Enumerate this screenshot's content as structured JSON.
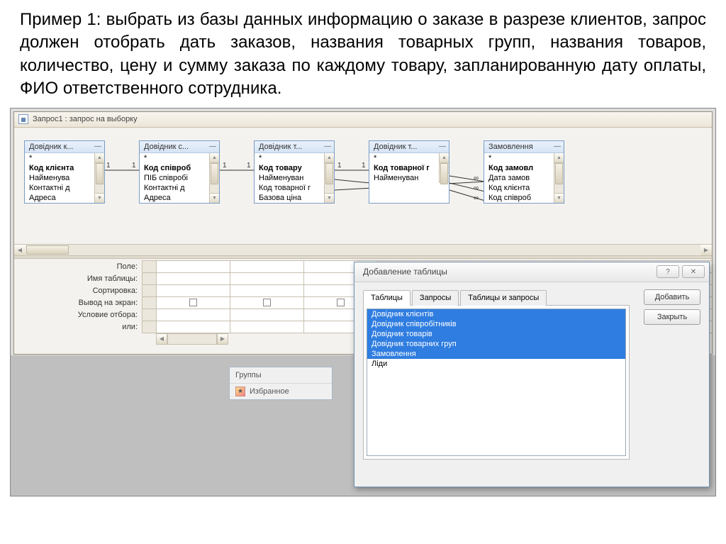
{
  "example_text": "Пример 1: выбрать из базы данных информацию о заказе в разрезе клиентов, запрос должен отобрать дать заказов, названия товарных групп, названия товаров, количество, цену и сумму заказа по каждому товару, запланированную дату оплаты, ФИО ответственного сотрудника.",
  "query_window": {
    "title": "Запрос1 : запрос на выборку"
  },
  "tables": [
    {
      "header": "Довідник к...",
      "fields": [
        "*",
        "Код клієнта",
        "Найменува",
        "Контактні д",
        "Адреса"
      ]
    },
    {
      "header": "Довідник с...",
      "fields": [
        "*",
        "Код співроб",
        "ПІБ співробі",
        "Контактні д",
        "Адреса"
      ]
    },
    {
      "header": "Довідник т...",
      "fields": [
        "*",
        "Код товару",
        "Найменуван",
        "Код товарної г",
        "Базова ціна"
      ]
    },
    {
      "header": "Довідник т...",
      "fields": [
        "*",
        "Код товарної г",
        "Найменуван"
      ]
    },
    {
      "header": "Замовлення",
      "fields": [
        "*",
        "Код замовл",
        "Дата замов",
        "Код клієнта",
        "Код співроб"
      ]
    }
  ],
  "rel_labels": {
    "one": "1",
    "many": "∞"
  },
  "grid_labels": [
    "Поле:",
    "Имя таблицы:",
    "Сортировка:",
    "Вывод на экран:",
    "Условие отбора:",
    "или:"
  ],
  "nav_panel": {
    "groups": "Группы",
    "favorites": "Избранное"
  },
  "dialog": {
    "title": "Добавление таблицы",
    "help_glyph": "?",
    "close_glyph": "✕",
    "tabs": [
      "Таблицы",
      "Запросы",
      "Таблицы и запросы"
    ],
    "items": [
      {
        "label": "Довідник клієнтів",
        "selected": true
      },
      {
        "label": "Довідник співробітників",
        "selected": true
      },
      {
        "label": "Довідник товарів",
        "selected": true
      },
      {
        "label": "Довідник товарних груп",
        "selected": true
      },
      {
        "label": "Замовлення",
        "selected": true
      },
      {
        "label": "Ліди",
        "selected": false
      }
    ],
    "buttons": {
      "add": "Добавить",
      "close": "Закрыть"
    }
  }
}
